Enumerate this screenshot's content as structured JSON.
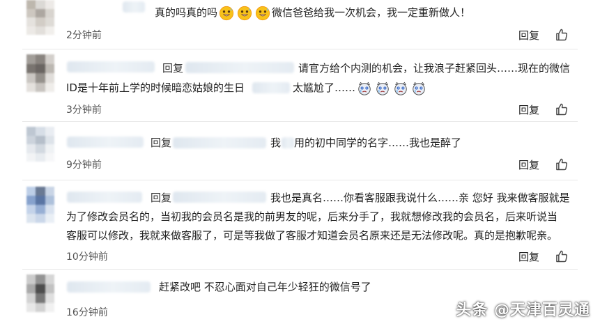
{
  "comments": [
    {
      "text_before_emoji": "真的吗真的吗",
      "emoji_name": "grinning-face-with-sweat-emoji",
      "text_after_emoji": "微信爸爸给我一次机会，我一定重新做人！",
      "time": "2分钟前",
      "reply_label": "回复"
    },
    {
      "reply_prefix": "回复",
      "line1": "请官方给个内测的机会，让我浪子赶紧回头……现在的微信",
      "line2_a": "ID是十年前上学的时候暗恋姑娘的生日",
      "line2_b": "太尴尬了……",
      "emoji_name": "crying-cat-face-emoji",
      "time": "3分钟前",
      "reply_label": "回复"
    },
    {
      "reply_prefix": "回复",
      "line1_a": "我",
      "line1_b": "用的初中同学的名字……我也是醉了",
      "time": "9分钟前",
      "reply_label": "回复"
    },
    {
      "reply_prefix": "回复",
      "line1": "我也是真名……你看客服跟我说什么……亲 您好 我来做客服就是",
      "line2": "为了修改会员名的，当初我的会员名是我的前男友的呢，后来分手了，我就想修改我的会员名，后来听说当",
      "line3": "客服可以修改，我就来做客服了，可是等我做了客服才知道会员名原来还是无法修改呢。真的是抱歉呢亲。",
      "time": "10分钟前",
      "reply_label": "回复"
    },
    {
      "line1": "赶紧改吧 不忍心面对自己年少轻狂的微信号了",
      "time": "16分钟前"
    }
  ],
  "icons": {
    "like": "thumbs-up-icon"
  },
  "watermark": "头条 @天津百灵通",
  "colors": {
    "text": "#222222",
    "muted": "#555555",
    "divider": "#e8e8e8",
    "emoji_yellow": "#f8c21a",
    "emoji_orange": "#f29a11"
  }
}
